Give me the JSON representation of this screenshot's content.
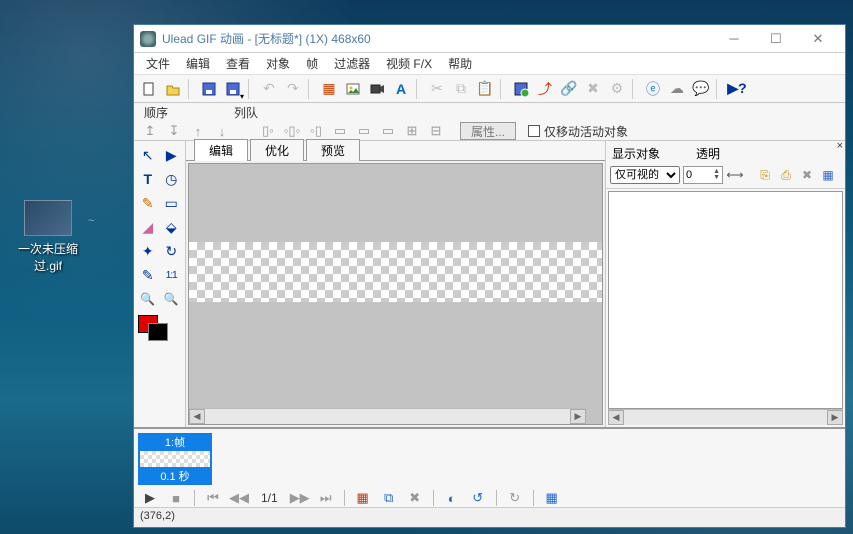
{
  "desktop": {
    "file_label": "一次未压缩过.gif"
  },
  "window": {
    "title": "Ulead GIF 动画 - [无标题*] (1X) 468x60",
    "menu": {
      "file": "文件",
      "edit": "编辑",
      "view": "查看",
      "object": "对象",
      "frame": "帧",
      "filter": "过滤器",
      "video": "视频 F/X",
      "help": "帮助"
    },
    "secondbar": {
      "label_order": "顺序",
      "label_queue": "列队",
      "prop_btn": "属性...",
      "checkbox": "仅移动活动对象"
    },
    "tabs": {
      "edit": "编辑",
      "optimize": "优化",
      "preview": "预览"
    },
    "tools": {
      "arrow": "↖",
      "shape": "▶",
      "text": "T",
      "clock": "◷",
      "brush": "✎",
      "pencil": "▭",
      "eraser": "◢",
      "bucket": "⬙",
      "wand": "✦",
      "rotate": "↻",
      "dropper": "✎",
      "oneone": "1:1",
      "zoomin": "🔍",
      "zoomout": "🔍"
    },
    "right": {
      "show_label": "显示对象",
      "trans_label": "透明",
      "dropdown": "仅可视的",
      "spinner": "0"
    },
    "timeline": {
      "frame_label": "1:帧",
      "duration": "0.1 秒",
      "counter": "1/1"
    },
    "status": "(376,2)"
  }
}
